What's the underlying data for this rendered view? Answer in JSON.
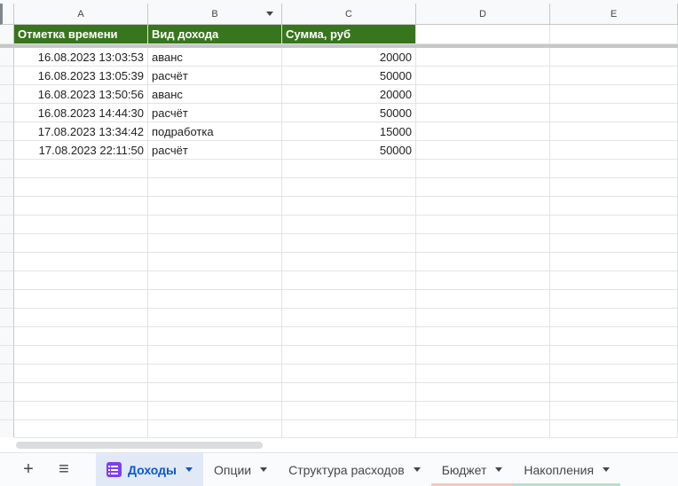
{
  "columns": [
    "A",
    "B",
    "C",
    "D",
    "E"
  ],
  "headers": [
    "Отметка времени",
    "Вид дохода",
    "Сумма, руб"
  ],
  "rows": [
    {
      "time": "16.08.2023 13:03:53",
      "type": "аванс",
      "sum": "20000"
    },
    {
      "time": "16.08.2023 13:05:39",
      "type": "расчёт",
      "sum": "50000"
    },
    {
      "time": "16.08.2023 13:50:56",
      "type": "аванс",
      "sum": "20000"
    },
    {
      "time": "16.08.2023 14:44:30",
      "type": "расчёт",
      "sum": "50000"
    },
    {
      "time": "17.08.2023 13:34:42",
      "type": "подработка",
      "sum": "15000"
    },
    {
      "time": "17.08.2023 22:11:50",
      "type": "расчёт",
      "sum": "50000"
    }
  ],
  "toolbar": {
    "add_sheet": "+",
    "all_sheets": "≡"
  },
  "tabs": [
    {
      "label": "Доходы",
      "active": true
    },
    {
      "label": "Опции"
    },
    {
      "label": "Структура расходов"
    },
    {
      "label": "Бюджет",
      "color": "#f4c7c3"
    },
    {
      "label": "Накопления",
      "color": "#b7e1cd"
    }
  ],
  "colors": {
    "header_fill": "#38761d",
    "header_text": "#ffffff",
    "active_tab": "#e1e9f7",
    "form_icon": "#7e3ff2"
  }
}
